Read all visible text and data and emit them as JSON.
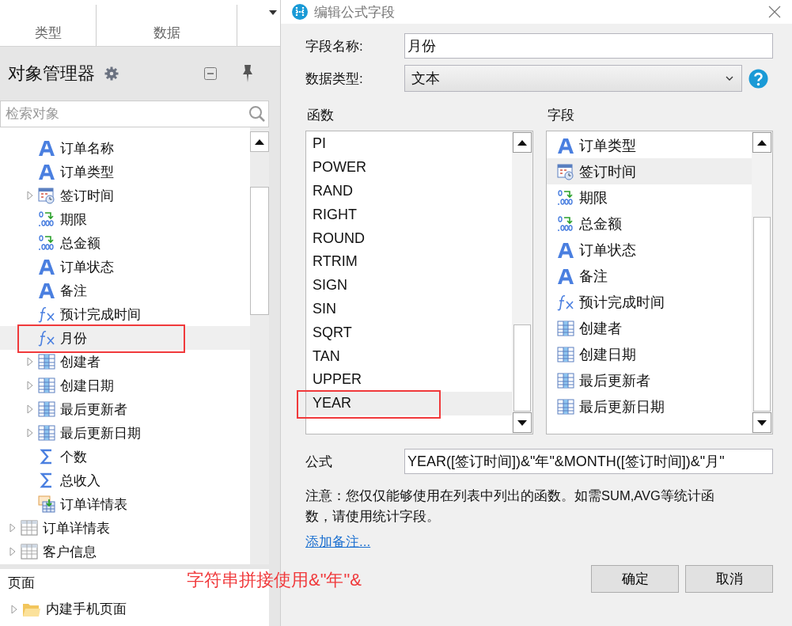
{
  "left_tabs": [
    {
      "label": "类型"
    },
    {
      "label": "数据"
    }
  ],
  "object_manager": {
    "title": "对象管理器",
    "search": {
      "placeholder": "检索对象"
    }
  },
  "tree": [
    {
      "children": [
        {
          "label": "订单名称",
          "kind": "text",
          "expandable": false,
          "selected": false,
          "marked": false
        },
        {
          "label": "订单类型",
          "kind": "text",
          "expandable": false,
          "selected": false,
          "marked": false
        },
        {
          "label": "签订时间",
          "kind": "date",
          "expandable": true,
          "selected": false,
          "marked": false
        },
        {
          "label": "期限",
          "kind": "number",
          "expandable": false,
          "selected": false,
          "marked": false
        },
        {
          "label": "总金额",
          "kind": "number",
          "expandable": false,
          "selected": false,
          "marked": false
        },
        {
          "label": "订单状态",
          "kind": "text",
          "expandable": false,
          "selected": false,
          "marked": false
        },
        {
          "label": "备注",
          "kind": "text",
          "expandable": false,
          "selected": false,
          "marked": false
        },
        {
          "label": "预计完成时间",
          "kind": "formula",
          "expandable": false,
          "selected": false,
          "marked": false
        },
        {
          "label": "月份",
          "kind": "formula",
          "expandable": false,
          "selected": true,
          "marked": true
        },
        {
          "label": "创建者",
          "kind": "table",
          "expandable": true,
          "selected": false,
          "marked": false
        },
        {
          "label": "创建日期",
          "kind": "table",
          "expandable": true,
          "selected": false,
          "marked": false
        },
        {
          "label": "最后更新者",
          "kind": "table",
          "expandable": true,
          "selected": false,
          "marked": false
        },
        {
          "label": "最后更新日期",
          "kind": "table",
          "expandable": true,
          "selected": false,
          "marked": false
        },
        {
          "label": "个数",
          "kind": "sum",
          "expandable": false,
          "selected": false,
          "marked": false
        },
        {
          "label": "总收入",
          "kind": "sum",
          "expandable": false,
          "selected": false,
          "marked": false
        },
        {
          "label": "订单详情表",
          "kind": "subtable",
          "expandable": false,
          "selected": false,
          "marked": false
        }
      ]
    },
    {
      "label": "订单详情表",
      "kind": "table",
      "expandable": true,
      "selected": false,
      "marked": false
    },
    {
      "label": "客户信息",
      "kind": "table",
      "expandable": true,
      "selected": false,
      "marked": false
    }
  ],
  "pages_panel": {
    "title": "页面",
    "items": [
      {
        "label": "内建手机页面",
        "kind": "folder",
        "expandable": true
      }
    ]
  },
  "dialog": {
    "title": "编辑公式字段",
    "name_label": "字段名称:",
    "name_value": "月份",
    "type_label": "数据类型:",
    "type_value": "文本",
    "functions": {
      "title": "函数",
      "items": [
        {
          "label": "PI",
          "selected": false,
          "marked": false
        },
        {
          "label": "POWER",
          "selected": false,
          "marked": false
        },
        {
          "label": "RAND",
          "selected": false,
          "marked": false
        },
        {
          "label": "RIGHT",
          "selected": false,
          "marked": false
        },
        {
          "label": "ROUND",
          "selected": false,
          "marked": false
        },
        {
          "label": "RTRIM",
          "selected": false,
          "marked": false
        },
        {
          "label": "SIGN",
          "selected": false,
          "marked": false
        },
        {
          "label": "SIN",
          "selected": false,
          "marked": false
        },
        {
          "label": "SQRT",
          "selected": false,
          "marked": false
        },
        {
          "label": "TAN",
          "selected": false,
          "marked": false
        },
        {
          "label": "UPPER",
          "selected": false,
          "marked": false
        },
        {
          "label": "YEAR",
          "selected": true,
          "marked": true
        }
      ]
    },
    "fields": {
      "title": "字段",
      "items": [
        {
          "label": "订单类型",
          "kind": "text",
          "selected": false
        },
        {
          "label": "签订时间",
          "kind": "date",
          "selected": true
        },
        {
          "label": "期限",
          "kind": "number",
          "selected": false
        },
        {
          "label": "总金额",
          "kind": "number",
          "selected": false
        },
        {
          "label": "订单状态",
          "kind": "text",
          "selected": false
        },
        {
          "label": "备注",
          "kind": "text",
          "selected": false
        },
        {
          "label": "预计完成时间",
          "kind": "formula",
          "selected": false
        },
        {
          "label": "创建者",
          "kind": "table",
          "selected": false
        },
        {
          "label": "创建日期",
          "kind": "table",
          "selected": false
        },
        {
          "label": "最后更新者",
          "kind": "table",
          "selected": false
        },
        {
          "label": "最后更新日期",
          "kind": "table",
          "selected": false
        }
      ]
    },
    "formula_label": "公式",
    "formula_value": "YEAR([签订时间])&\"年\"&MONTH([签订时间])&\"月\"",
    "note": "注意：您仅仅能够使用在列表中列出的函数。如需SUM,AVG等统计函数，请使用统计字段。",
    "link": "添加备注...",
    "buttons": [
      "确定",
      "取消"
    ]
  },
  "annotation": "字符串拼接使用&\"年\"&"
}
